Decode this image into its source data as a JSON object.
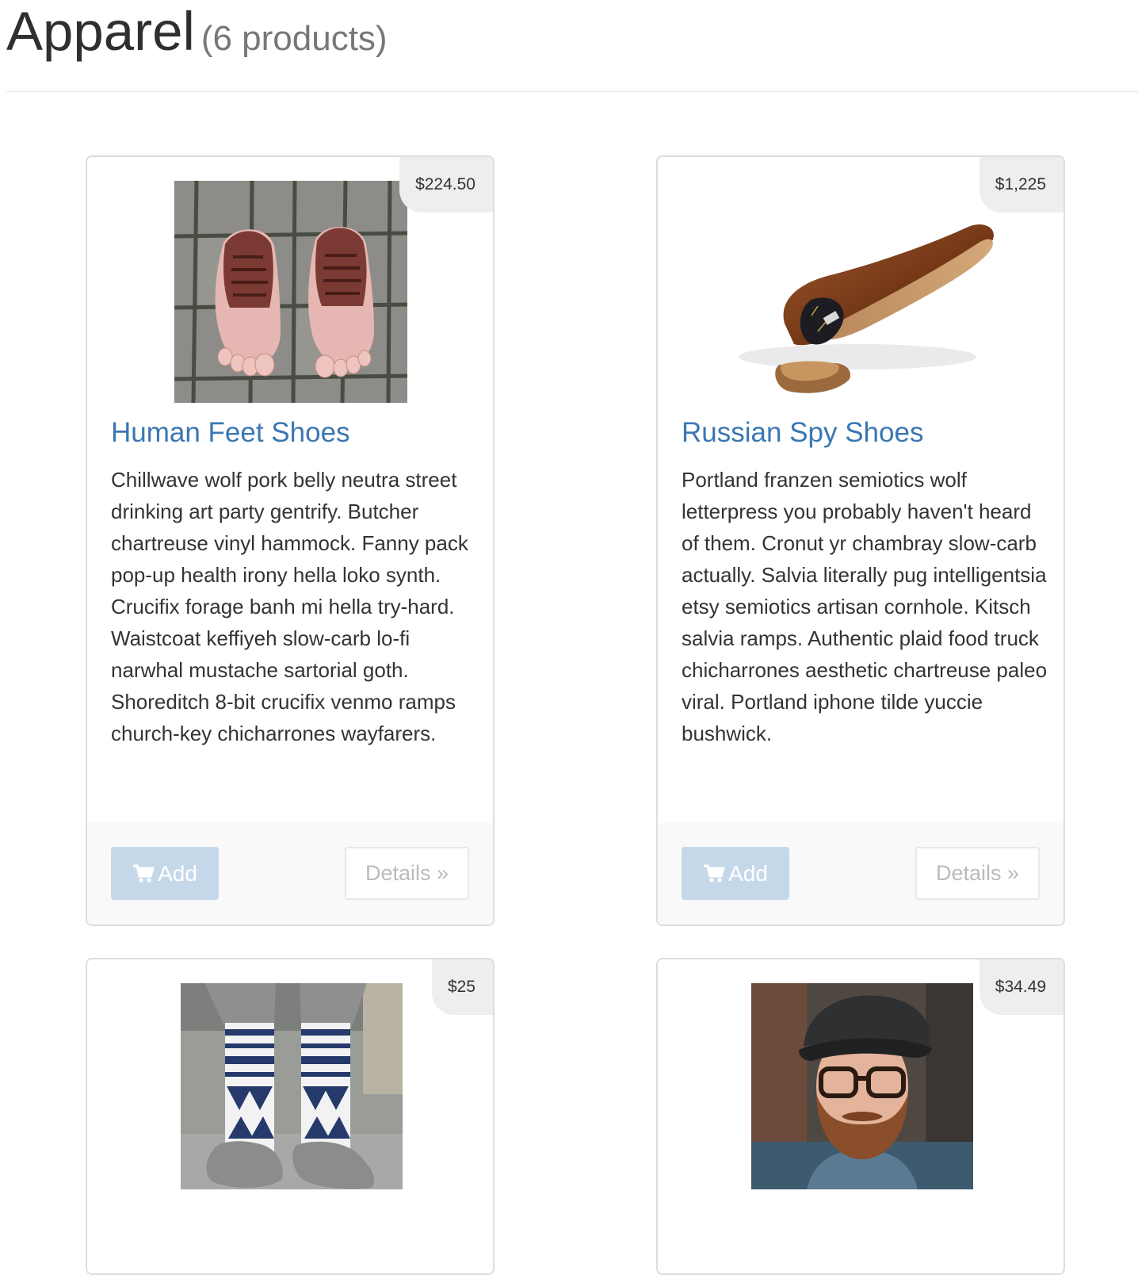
{
  "header": {
    "title": "Apparel",
    "count": "(6 products)"
  },
  "products": [
    {
      "name": "Human Feet Shoes",
      "price": "$224.50",
      "description": "Chillwave wolf pork belly neutra street drinking art party gentrify. Butcher chartreuse vinyl hammock. Fanny pack pop-up health irony hella loko synth. Crucifix forage banh mi hella try-hard. Waistcoat keffiyeh slow-carb lo-fi narwhal mustache sartorial goth. Shoreditch 8-bit crucifix venmo ramps church-key chicharrones wayfarers.",
      "add_label": "Add",
      "details_label": "Details »"
    },
    {
      "name": "Russian Spy Shoes",
      "price": "$1,225",
      "description": "Portland franzen semiotics wolf letterpress you probably haven't heard of them. Cronut yr chambray slow-carb actually. Salvia literally pug intelligentsia etsy semiotics artisan cornhole. Kitsch salvia ramps. Authentic plaid food truck chicharrones aesthetic chartreuse paleo viral. Portland iphone tilde yuccie bushwick.",
      "add_label": "Add",
      "details_label": "Details »"
    },
    {
      "price": "$25"
    },
    {
      "price": "$34.49"
    }
  ],
  "icons": {
    "cart": "shopping-cart-icon"
  },
  "colors": {
    "link": "#3a77b3",
    "add_button": "#c5d8ea",
    "price_tag_bg": "#eeeeee"
  }
}
